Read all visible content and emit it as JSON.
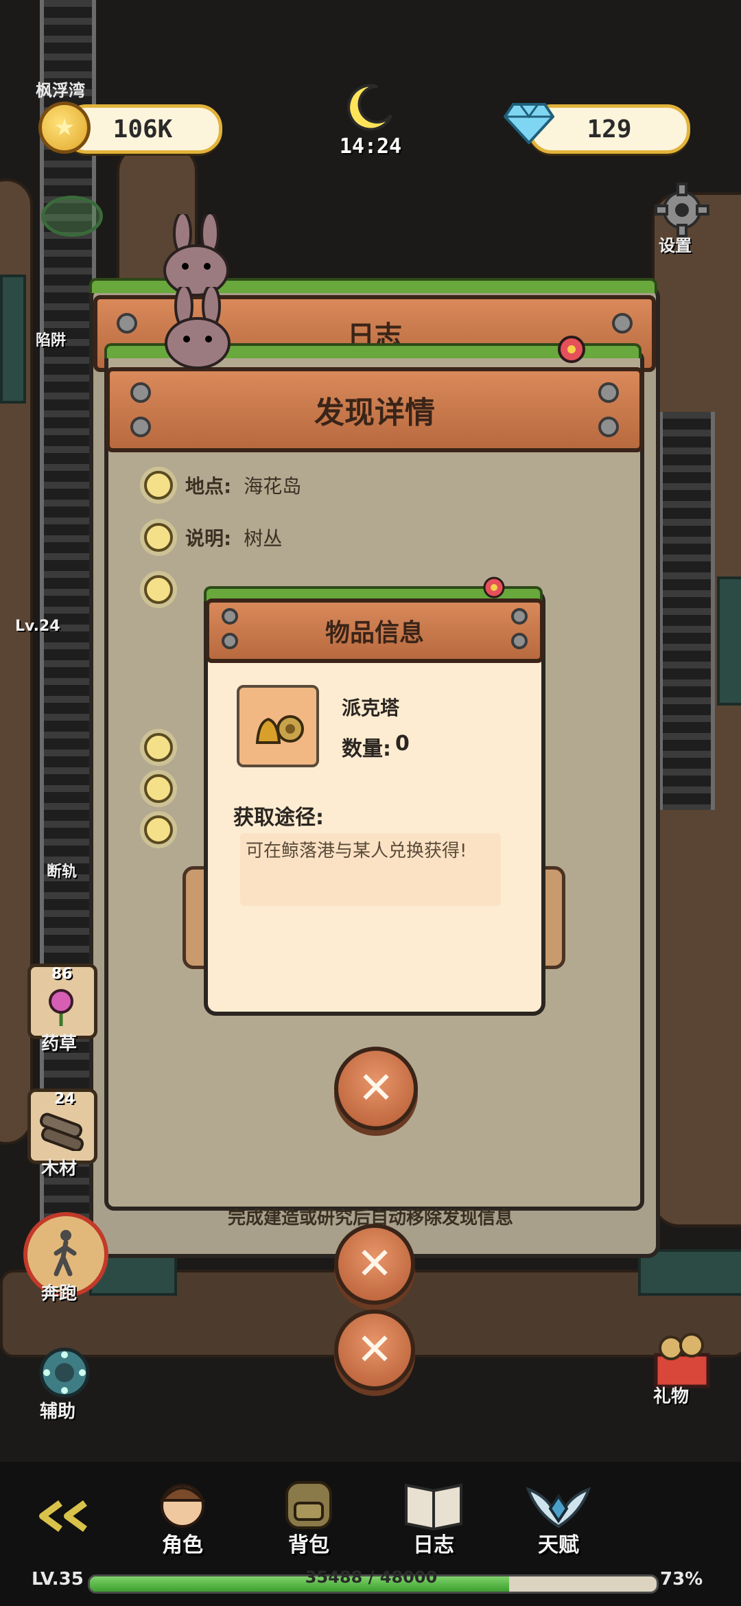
{
  "hud": {
    "location_label": "枫浮湾",
    "coins": "106K",
    "time": "14:24",
    "gems": "129",
    "settings_label": "设置",
    "side_label_upper": "陷阱",
    "side_label_level": "Lv.24",
    "side_label_lower": "断轨"
  },
  "back_panel": {
    "title": "日志"
  },
  "discovery_panel": {
    "title": "发现详情",
    "rows": [
      {
        "key": "地点:",
        "value": "海花岛"
      },
      {
        "key": "说明:",
        "value": "树丛"
      }
    ],
    "footer_note": "完成建造或研究后自动移除发现信息"
  },
  "item_dialog": {
    "title": "物品信息",
    "item_name": "派克塔",
    "quantity_label": "数量:",
    "quantity": "0",
    "source_heading": "获取途径:",
    "source_text": "可在鲸落港与某人兑换获得!"
  },
  "side_items": [
    {
      "count": "86",
      "label": "药草"
    },
    {
      "count": "24",
      "label": "木材"
    }
  ],
  "side_buttons": {
    "run_label": "奔跑",
    "assist_label": "辅助",
    "gift_label": "礼物"
  },
  "nav": {
    "back_icon": "double-chevron-left-icon",
    "items": [
      {
        "label": "角色",
        "icon": "character-icon"
      },
      {
        "label": "背包",
        "icon": "backpack-icon"
      },
      {
        "label": "日志",
        "icon": "journal-icon"
      },
      {
        "label": "天赋",
        "icon": "talent-icon"
      }
    ]
  },
  "xp": {
    "level": "LV.35",
    "progress_text": "35488 / 48000",
    "percent_text": "73%",
    "fraction": 0.74
  },
  "colors": {
    "accent_gold": "#e2b33a",
    "plank": "#d9895a",
    "dialog_bg": "#fdecd2",
    "xp_green": "#3c9e2e"
  }
}
